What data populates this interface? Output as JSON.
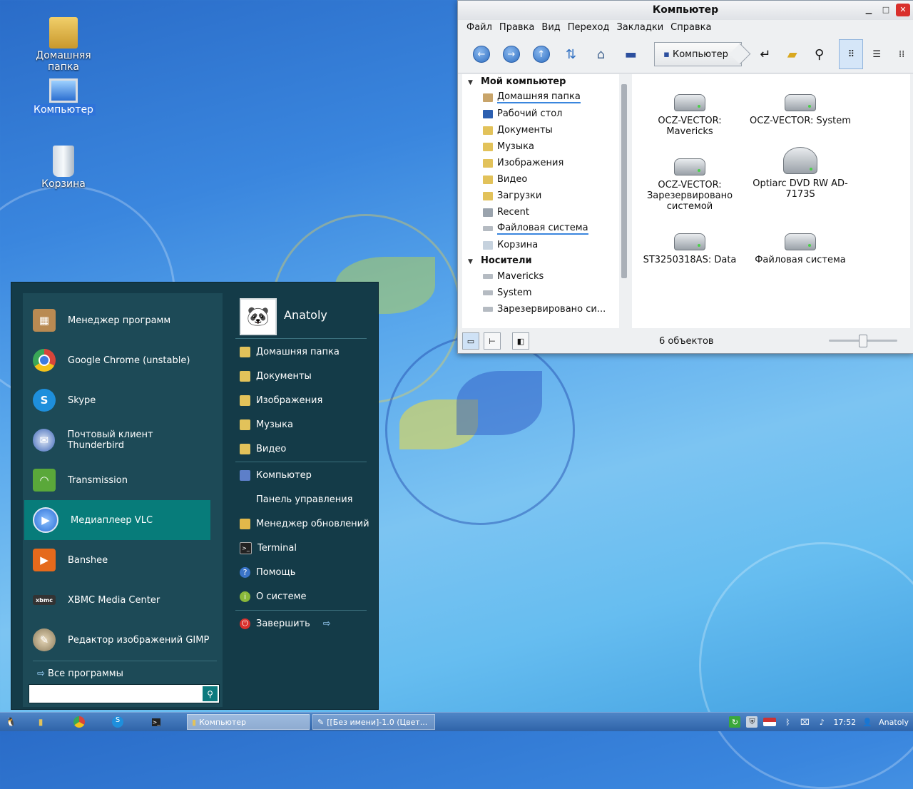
{
  "desktop": {
    "icons": [
      {
        "label": "Домашняя папка",
        "icon": "home-folder-icon"
      },
      {
        "label": "Компьютер",
        "icon": "computer-icon"
      },
      {
        "label": "Корзина",
        "icon": "trash-icon"
      }
    ]
  },
  "window": {
    "title": "Компьютер",
    "menu": [
      "Файл",
      "Правка",
      "Вид",
      "Переход",
      "Закладки",
      "Справка"
    ],
    "location": "Компьютер",
    "sidebar": {
      "section1": "Мой компьютер",
      "places": [
        "Домашняя папка",
        "Рабочий стол",
        "Документы",
        "Музыка",
        "Изображения",
        "Видео",
        "Загрузки",
        "Recent",
        "Файловая система",
        "Корзина"
      ],
      "section2": "Носители",
      "devices": [
        "Mavericks",
        "System",
        "Зарезервировано си..."
      ]
    },
    "items": [
      {
        "name": "OCZ-VECTOR:\nMavericks",
        "icon": "hard-drive-icon"
      },
      {
        "name": "OCZ-VECTOR: System",
        "icon": "hard-drive-icon"
      },
      {
        "name": "OCZ-VECTOR:\nЗарезервировано\nсистемой",
        "icon": "hard-drive-icon"
      },
      {
        "name": "Optiarc DVD RW AD-\n7173S",
        "icon": "optical-drive-icon"
      },
      {
        "name": "ST3250318AS: Data",
        "icon": "hard-drive-icon"
      },
      {
        "name": "Файловая система",
        "icon": "hard-drive-icon"
      }
    ],
    "status": "6 объектов"
  },
  "start_menu": {
    "apps": [
      {
        "label": "Менеджер программ",
        "icon": "software-manager-icon",
        "color": "#b98a52"
      },
      {
        "label": "Google Chrome (unstable)",
        "icon": "chrome-icon",
        "color": "#d8453a"
      },
      {
        "label": "Skype",
        "icon": "skype-icon",
        "color": "#1e8fdc"
      },
      {
        "label": "Почтовый клиент Thunderbird",
        "icon": "thunderbird-icon",
        "color": "#3a64b8"
      },
      {
        "label": "Transmission",
        "icon": "transmission-icon",
        "color": "#5aa83a"
      },
      {
        "label": "Медиаплеер VLC",
        "icon": "vlc-icon",
        "color": "#2b6fd6"
      },
      {
        "label": "Banshee",
        "icon": "banshee-icon",
        "color": "#e56a1c"
      },
      {
        "label": "XBMC Media Center",
        "icon": "xbmc-icon",
        "color": "#333333"
      },
      {
        "label": "Редактор изображений GIMP",
        "icon": "gimp-icon",
        "color": "#8a7a5a"
      }
    ],
    "all_programs": "Все программы",
    "search_value": "",
    "user": "Anatoly",
    "places": [
      "Домашняя папка",
      "Документы",
      "Изображения",
      "Музыка",
      "Видео"
    ],
    "system": [
      "Компьютер",
      "Панель управления",
      "Менеджер обновлений",
      "Terminal",
      "Помощь",
      "О системе"
    ],
    "shutdown": "Завершить"
  },
  "taskbar": {
    "tasks": [
      "Компьютер",
      "[[Без имени]-1.0 (Цвет..."
    ],
    "time": "17:52",
    "user": "Anatoly"
  },
  "colors": {
    "accent": "#077c7a",
    "menu_bg": "#143b48",
    "selection": "#2f73d9"
  }
}
